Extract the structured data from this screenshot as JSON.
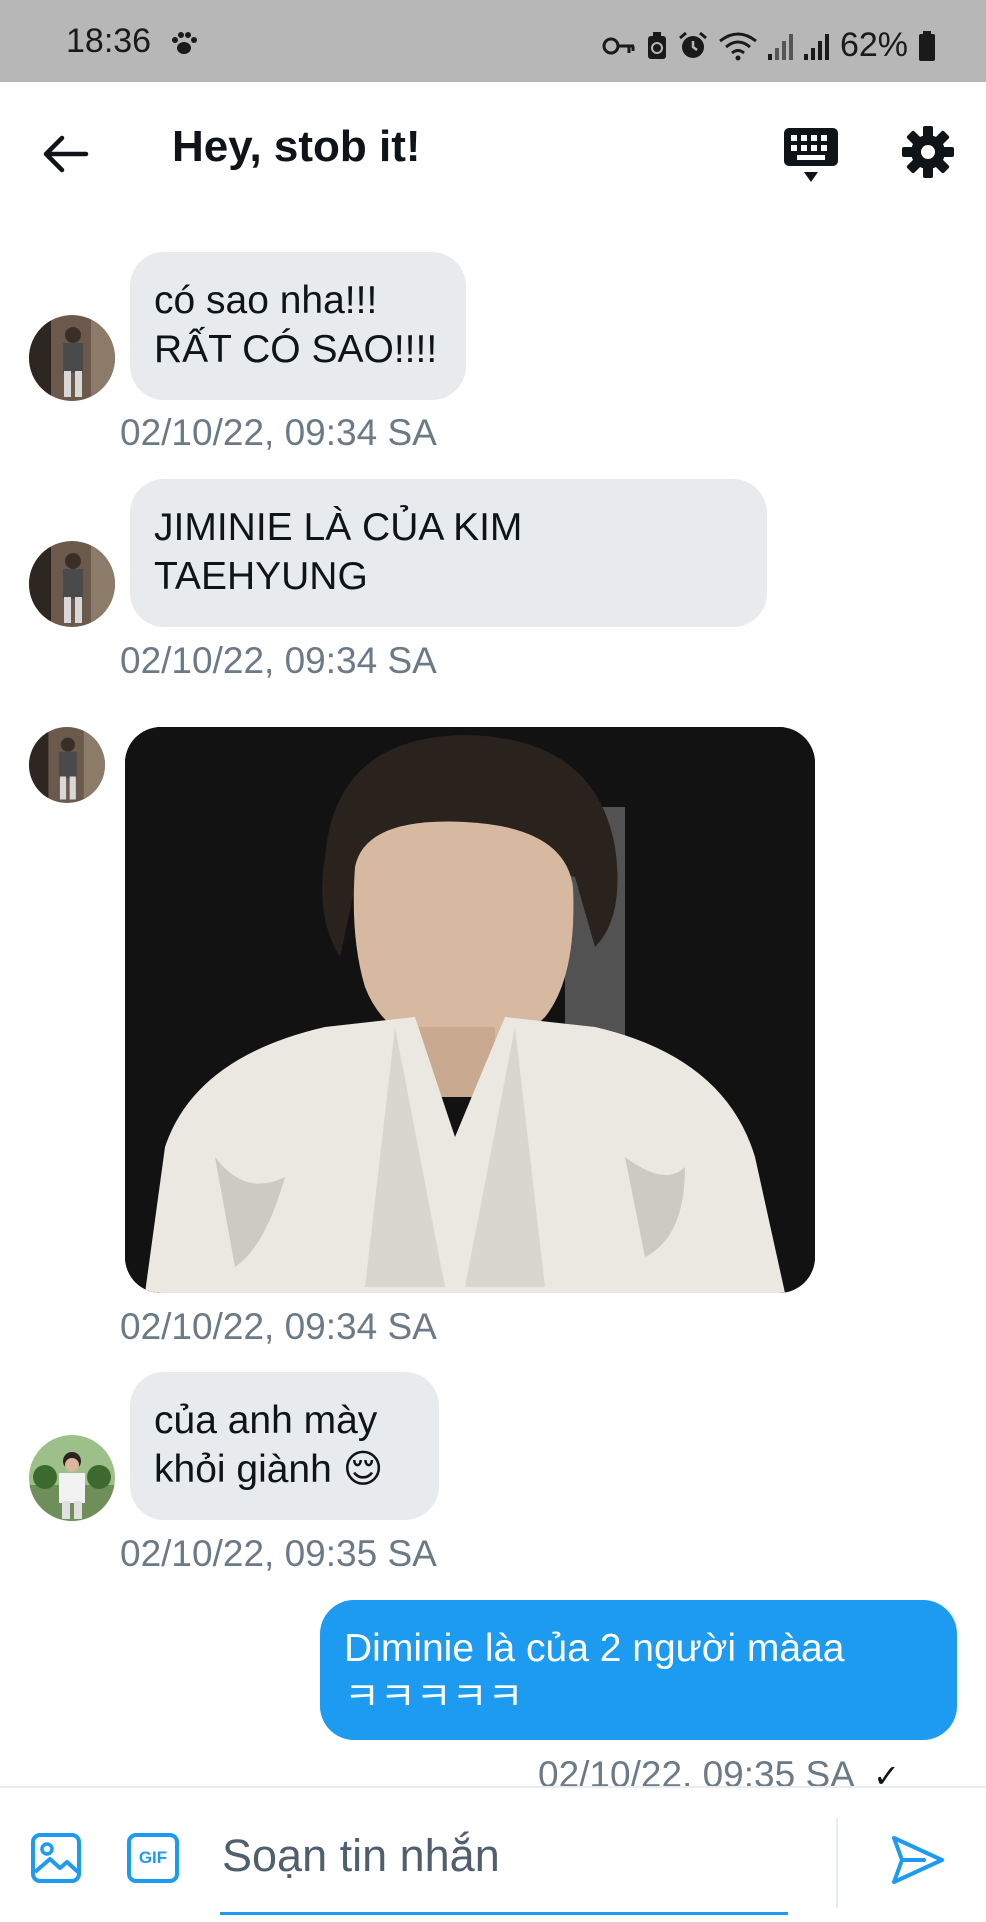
{
  "status_bar": {
    "time": "18:36",
    "battery": "62%",
    "icons": [
      "paw-icon",
      "key-icon",
      "battery-saver-icon",
      "alarm-icon",
      "wifi-icon",
      "signal-icon",
      "signal-icon",
      "battery-icon"
    ]
  },
  "header": {
    "title": "Hey, stob it!",
    "icons": [
      "back-arrow-icon",
      "keyboard-icon",
      "gear-icon"
    ]
  },
  "messages": [
    {
      "direction": "in",
      "lines": [
        "có sao nha!!!",
        "RẤT CÓ SAO!!!!"
      ],
      "timestamp": "02/10/22, 09:34 SA"
    },
    {
      "direction": "in",
      "lines": [
        "JIMINIE LÀ CỦA KIM",
        "TAEHYUNG"
      ],
      "timestamp": "02/10/22, 09:34 SA"
    },
    {
      "direction": "in",
      "type": "image",
      "timestamp": "02/10/22, 09:34 SA"
    },
    {
      "direction": "in",
      "lines": [
        "của anh mày",
        "khỏi giành 😌"
      ],
      "timestamp": "02/10/22, 09:35 SA"
    },
    {
      "direction": "out",
      "lines": [
        "Diminie là của 2 người màaa",
        "ㅋㅋㅋㅋㅋ"
      ],
      "timestamp": "02/10/22, 09:35 SA",
      "status": "✓"
    }
  ],
  "composer": {
    "placeholder": "Soạn tin nhắn",
    "gif_label": "GIF",
    "icons": [
      "image-icon",
      "gif-icon",
      "send-icon"
    ]
  },
  "colors": {
    "accent": "#1d9bf0",
    "incoming_bubble": "#e7ebee",
    "timestamp": "#6b7a86",
    "status_bar": "#b7b7b7"
  }
}
